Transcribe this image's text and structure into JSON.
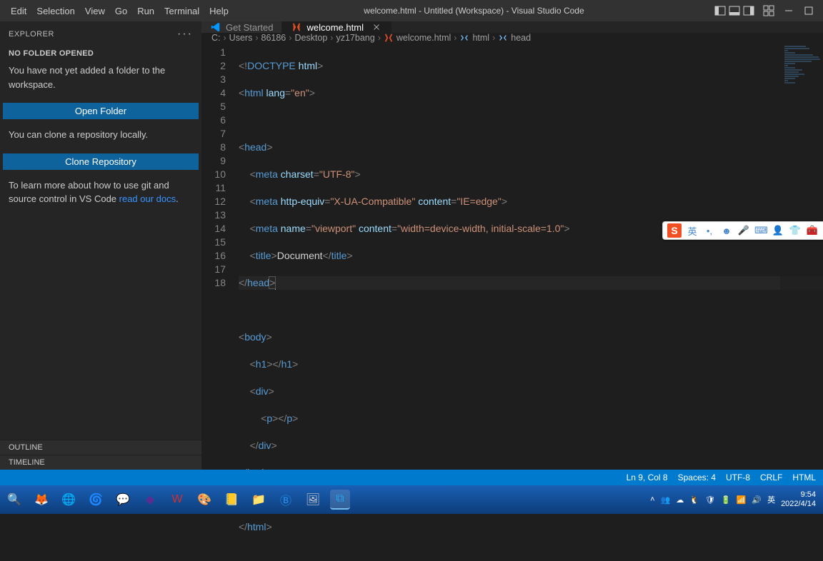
{
  "menubar": {
    "items": [
      "Edit",
      "Selection",
      "View",
      "Go",
      "Run",
      "Terminal",
      "Help"
    ],
    "title": "welcome.html - Untitled (Workspace) - Visual Studio Code"
  },
  "sidebar": {
    "explorer_label": "EXPLORER",
    "section_title": "NO FOLDER OPENED",
    "no_folder_text": "You have not yet added a folder to the workspace.",
    "open_folder_btn": "Open Folder",
    "clone_hint": "You can clone a repository locally.",
    "clone_btn": "Clone Repository",
    "docs_text_prefix": "To learn more about how to use git and source control in VS Code ",
    "docs_link": "read our docs",
    "docs_suffix": ".",
    "outline_label": "OUTLINE",
    "timeline_label": "TIMELINE"
  },
  "tabs": [
    {
      "label": "Get Started",
      "active": false,
      "icon": "vscode"
    },
    {
      "label": "welcome.html",
      "active": true,
      "icon": "html",
      "closable": true
    }
  ],
  "breadcrumb": [
    "C:",
    "Users",
    "86186",
    "Desktop",
    "yz17bang",
    "welcome.html",
    "html",
    "head"
  ],
  "code_lines": [
    "1",
    "2",
    "3",
    "4",
    "5",
    "6",
    "7",
    "8",
    "9",
    "10",
    "11",
    "12",
    "13",
    "14",
    "15",
    "16",
    "17",
    "18"
  ],
  "statusbar": {
    "pos": "Ln 9, Col 8",
    "spaces": "Spaces: 4",
    "encoding": "UTF-8",
    "eol": "CRLF",
    "lang": "HTML"
  },
  "ime": {
    "lang": "英"
  },
  "clock": {
    "time": "9:54",
    "date": "2022/4/14"
  }
}
